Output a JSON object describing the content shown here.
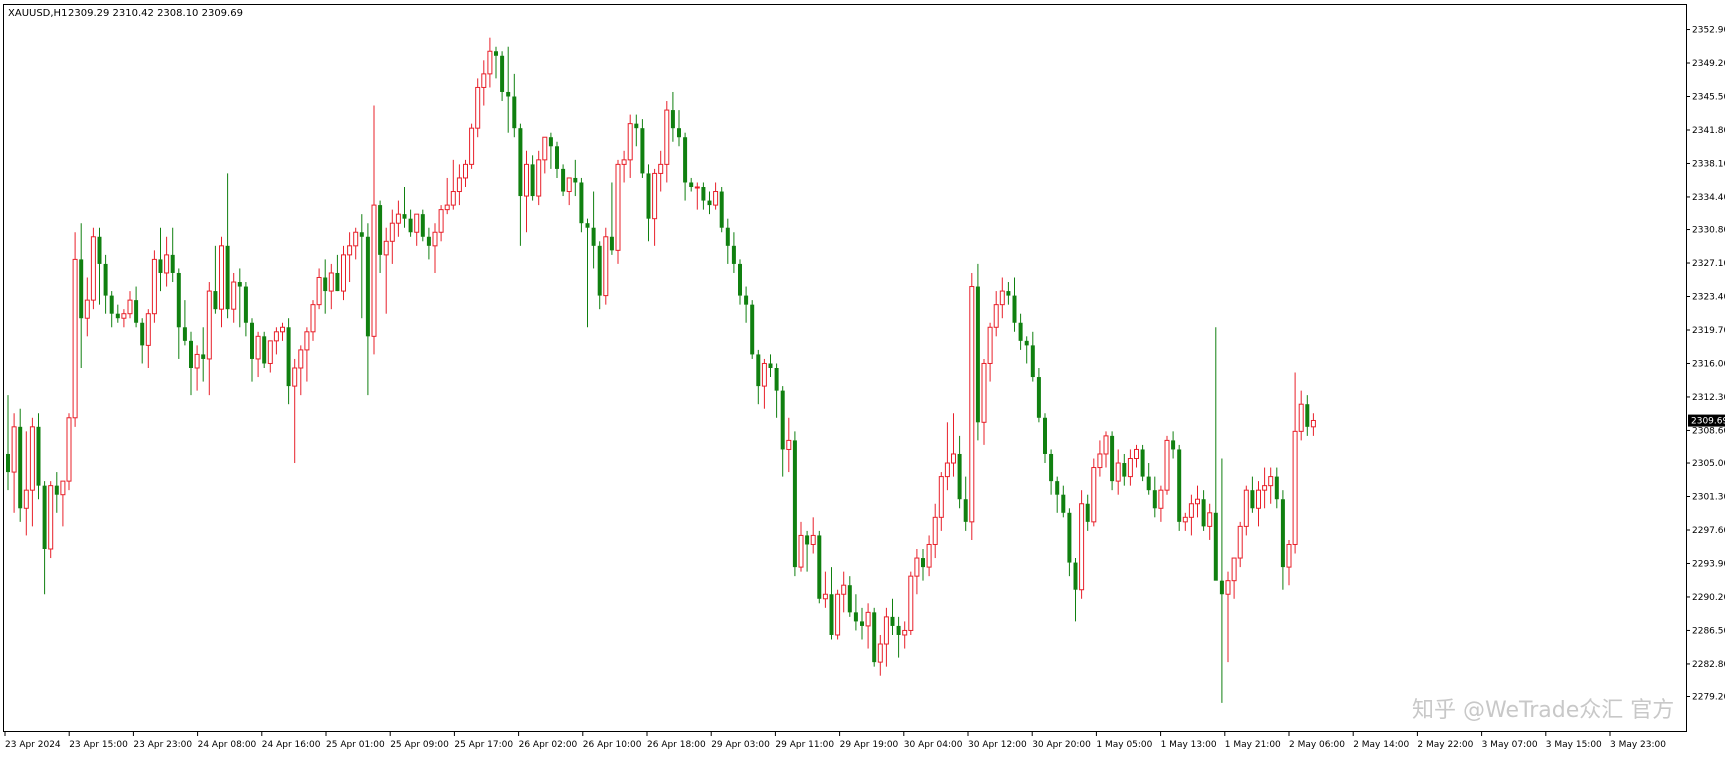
{
  "header": {
    "symbol": "XAUUSD,H1",
    "ohlc": "2309.29 2310.42 2308.10 2309.69"
  },
  "watermark": "知乎 @WeTrade众汇 官方",
  "colors": {
    "bull": "#e8202a",
    "bear": "#108010",
    "axis": "#000000",
    "background": "#ffffff",
    "price_marker": "#000000"
  },
  "chart_data": {
    "type": "candlestick",
    "series_name": "XAUUSD,H1",
    "ylim": [
      2275.5,
      2355.5
    ],
    "grid": false,
    "y_ticks": [
      "2352.90",
      "2349.20",
      "2345.50",
      "2341.80",
      "2338.10",
      "2334.40",
      "2330.80",
      "2327.10",
      "2323.40",
      "2319.70",
      "2316.00",
      "2312.30",
      "2308.60",
      "2305.00",
      "2301.30",
      "2297.60",
      "2293.90",
      "2290.20",
      "2286.50",
      "2282.80",
      "2279.20"
    ],
    "x_ticks": [
      "23 Apr 2024",
      "23 Apr 15:00",
      "23 Apr 23:00",
      "24 Apr 08:00",
      "24 Apr 16:00",
      "25 Apr 01:00",
      "25 Apr 09:00",
      "25 Apr 17:00",
      "26 Apr 02:00",
      "26 Apr 10:00",
      "26 Apr 18:00",
      "29 Apr 03:00",
      "29 Apr 11:00",
      "29 Apr 19:00",
      "30 Apr 04:00",
      "30 Apr 12:00",
      "30 Apr 20:00",
      "1 May 05:00",
      "1 May 13:00",
      "1 May 21:00",
      "2 May 06:00",
      "2 May 14:00",
      "2 May 22:00",
      "3 May 07:00",
      "3 May 15:00",
      "3 May 23:00"
    ],
    "current_price": "2309.69",
    "candles": [
      [
        2306.0,
        2312.5,
        2302.0,
        2304.0
      ],
      [
        2304.0,
        2310.5,
        2299.5,
        2309.0
      ],
      [
        2309.0,
        2311.0,
        2298.5,
        2300.0
      ],
      [
        2300.0,
        2308.5,
        2297.0,
        2302.0
      ],
      [
        2302.0,
        2310.0,
        2298.0,
        2309.0
      ],
      [
        2309.0,
        2310.5,
        2301.0,
        2302.5
      ],
      [
        2302.5,
        2303.0,
        2290.5,
        2295.5
      ],
      [
        2295.5,
        2303.0,
        2294.5,
        2302.5
      ],
      [
        2302.5,
        2304.0,
        2299.5,
        2301.5
      ],
      [
        2301.5,
        2303.0,
        2298.0,
        2303.0
      ],
      [
        2303.0,
        2310.5,
        2302.0,
        2310.0
      ],
      [
        2310.0,
        2330.5,
        2309.0,
        2327.5
      ],
      [
        2327.5,
        2331.5,
        2315.5,
        2321.0
      ],
      [
        2321.0,
        2325.5,
        2319.0,
        2323.0
      ],
      [
        2323.0,
        2331.0,
        2322.0,
        2330.0
      ],
      [
        2330.0,
        2331.0,
        2322.5,
        2327.0
      ],
      [
        2327.0,
        2328.0,
        2321.5,
        2323.5
      ],
      [
        2323.5,
        2324.0,
        2320.0,
        2321.5
      ],
      [
        2321.5,
        2322.5,
        2320.5,
        2321.0
      ],
      [
        2321.0,
        2322.0,
        2320.0,
        2321.5
      ],
      [
        2321.5,
        2324.0,
        2321.0,
        2323.0
      ],
      [
        2323.0,
        2324.5,
        2320.0,
        2320.5
      ],
      [
        2320.5,
        2321.0,
        2316.0,
        2318.0
      ],
      [
        2318.0,
        2322.0,
        2315.5,
        2321.5
      ],
      [
        2321.5,
        2328.5,
        2320.5,
        2327.5
      ],
      [
        2327.5,
        2331.0,
        2324.0,
        2326.0
      ],
      [
        2326.0,
        2330.0,
        2324.5,
        2328.0
      ],
      [
        2328.0,
        2331.0,
        2325.0,
        2326.0
      ],
      [
        2326.0,
        2326.5,
        2316.5,
        2320.0
      ],
      [
        2320.0,
        2323.0,
        2318.0,
        2318.5
      ],
      [
        2318.5,
        2319.5,
        2312.5,
        2315.5
      ],
      [
        2315.5,
        2318.0,
        2313.0,
        2317.0
      ],
      [
        2317.0,
        2320.0,
        2314.0,
        2316.5
      ],
      [
        2316.5,
        2325.0,
        2312.5,
        2324.0
      ],
      [
        2324.0,
        2329.0,
        2321.5,
        2322.0
      ],
      [
        2322.0,
        2330.0,
        2320.0,
        2329.0
      ],
      [
        2329.0,
        2337.0,
        2321.0,
        2322.0
      ],
      [
        2322.0,
        2326.0,
        2320.5,
        2325.0
      ],
      [
        2325.0,
        2326.5,
        2320.0,
        2324.5
      ],
      [
        2324.5,
        2325.0,
        2319.0,
        2320.5
      ],
      [
        2320.5,
        2321.0,
        2314.0,
        2316.5
      ],
      [
        2316.5,
        2319.5,
        2314.5,
        2319.0
      ],
      [
        2319.0,
        2319.5,
        2315.5,
        2316.0
      ],
      [
        2316.0,
        2318.5,
        2315.0,
        2318.5
      ],
      [
        2318.5,
        2320.0,
        2317.0,
        2319.5
      ],
      [
        2319.5,
        2320.5,
        2318.5,
        2320.0
      ],
      [
        2320.0,
        2321.0,
        2311.5,
        2313.5
      ],
      [
        2313.5,
        2316.5,
        2305.0,
        2315.5
      ],
      [
        2315.5,
        2318.0,
        2312.5,
        2317.5
      ],
      [
        2317.5,
        2320.0,
        2314.0,
        2319.5
      ],
      [
        2319.5,
        2323.0,
        2318.5,
        2322.5
      ],
      [
        2322.5,
        2326.5,
        2322.0,
        2325.5
      ],
      [
        2325.5,
        2327.5,
        2321.5,
        2324.0
      ],
      [
        2324.0,
        2327.0,
        2322.0,
        2326.0
      ],
      [
        2326.0,
        2328.0,
        2324.0,
        2324.0
      ],
      [
        2324.0,
        2329.0,
        2323.0,
        2328.0
      ],
      [
        2328.0,
        2330.5,
        2325.0,
        2329.0
      ],
      [
        2329.0,
        2331.0,
        2327.5,
        2330.5
      ],
      [
        2330.5,
        2332.5,
        2321.0,
        2330.0
      ],
      [
        2330.0,
        2331.5,
        2312.5,
        2319.0
      ],
      [
        2319.0,
        2344.5,
        2317.0,
        2333.5
      ],
      [
        2333.5,
        2334.0,
        2326.0,
        2328.0
      ],
      [
        2328.0,
        2331.0,
        2321.5,
        2329.5
      ],
      [
        2329.5,
        2333.0,
        2327.0,
        2331.5
      ],
      [
        2331.5,
        2334.0,
        2330.0,
        2332.5
      ],
      [
        2332.5,
        2335.5,
        2331.0,
        2332.0
      ],
      [
        2332.0,
        2333.0,
        2330.0,
        2330.5
      ],
      [
        2330.5,
        2332.5,
        2329.0,
        2332.5
      ],
      [
        2332.5,
        2333.0,
        2329.5,
        2330.0
      ],
      [
        2330.0,
        2331.0,
        2327.5,
        2329.0
      ],
      [
        2329.0,
        2331.5,
        2326.0,
        2330.5
      ],
      [
        2330.5,
        2333.5,
        2329.5,
        2333.0
      ],
      [
        2333.0,
        2336.5,
        2332.5,
        2333.5
      ],
      [
        2333.5,
        2338.5,
        2333.0,
        2335.0
      ],
      [
        2335.0,
        2338.0,
        2333.5,
        2336.5
      ],
      [
        2336.5,
        2338.5,
        2335.5,
        2338.0
      ],
      [
        2338.0,
        2342.5,
        2337.5,
        2342.0
      ],
      [
        2342.0,
        2347.5,
        2341.0,
        2346.5
      ],
      [
        2346.5,
        2349.5,
        2344.5,
        2348.0
      ],
      [
        2348.0,
        2352.0,
        2346.5,
        2350.5
      ],
      [
        2350.5,
        2351.0,
        2347.5,
        2350.0
      ],
      [
        2350.0,
        2350.5,
        2345.0,
        2346.0
      ],
      [
        2346.0,
        2351.0,
        2341.5,
        2345.5
      ],
      [
        2345.5,
        2348.0,
        2341.0,
        2342.0
      ],
      [
        2342.0,
        2342.5,
        2329.0,
        2334.5
      ],
      [
        2334.5,
        2339.5,
        2330.5,
        2338.0
      ],
      [
        2338.0,
        2339.0,
        2334.0,
        2334.5
      ],
      [
        2334.5,
        2339.5,
        2333.5,
        2338.5
      ],
      [
        2338.5,
        2341.0,
        2337.0,
        2341.0
      ],
      [
        2341.0,
        2341.5,
        2337.5,
        2340.0
      ],
      [
        2340.0,
        2340.5,
        2336.5,
        2337.5
      ],
      [
        2337.5,
        2338.0,
        2334.5,
        2335.0
      ],
      [
        2335.0,
        2336.5,
        2333.5,
        2336.5
      ],
      [
        2336.5,
        2338.5,
        2334.5,
        2336.0
      ],
      [
        2336.0,
        2336.5,
        2330.5,
        2331.5
      ],
      [
        2331.5,
        2332.0,
        2320.0,
        2331.0
      ],
      [
        2331.0,
        2335.0,
        2326.5,
        2329.0
      ],
      [
        2329.0,
        2329.5,
        2322.0,
        2323.5
      ],
      [
        2323.5,
        2331.0,
        2322.5,
        2330.0
      ],
      [
        2330.0,
        2336.0,
        2328.0,
        2328.5
      ],
      [
        2328.5,
        2338.5,
        2327.0,
        2338.0
      ],
      [
        2338.0,
        2339.5,
        2336.0,
        2338.5
      ],
      [
        2338.5,
        2343.5,
        2336.5,
        2342.5
      ],
      [
        2342.5,
        2343.5,
        2340.0,
        2342.0
      ],
      [
        2342.0,
        2343.0,
        2336.5,
        2337.0
      ],
      [
        2337.0,
        2338.0,
        2329.5,
        2332.0
      ],
      [
        2332.0,
        2337.5,
        2329.0,
        2337.0
      ],
      [
        2337.0,
        2339.5,
        2335.0,
        2338.0
      ],
      [
        2338.0,
        2345.0,
        2336.0,
        2344.0
      ],
      [
        2344.0,
        2346.0,
        2340.5,
        2342.0
      ],
      [
        2342.0,
        2344.0,
        2340.0,
        2341.0
      ],
      [
        2341.0,
        2341.5,
        2334.0,
        2336.0
      ],
      [
        2336.0,
        2336.5,
        2335.0,
        2335.5
      ],
      [
        2335.5,
        2336.0,
        2333.0,
        2335.5
      ],
      [
        2335.5,
        2336.0,
        2333.0,
        2334.0
      ],
      [
        2334.0,
        2335.0,
        2332.5,
        2333.5
      ],
      [
        2333.5,
        2336.0,
        2333.0,
        2335.0
      ],
      [
        2335.0,
        2335.5,
        2330.5,
        2331.0
      ],
      [
        2331.0,
        2332.0,
        2327.0,
        2329.0
      ],
      [
        2329.0,
        2330.5,
        2326.0,
        2327.0
      ],
      [
        2327.0,
        2327.5,
        2322.5,
        2323.5
      ],
      [
        2323.5,
        2324.5,
        2320.5,
        2322.5
      ],
      [
        2322.5,
        2323.0,
        2316.5,
        2317.0
      ],
      [
        2317.0,
        2317.5,
        2311.5,
        2313.5
      ],
      [
        2313.5,
        2316.5,
        2311.0,
        2316.0
      ],
      [
        2316.0,
        2317.0,
        2314.5,
        2315.5
      ],
      [
        2315.5,
        2316.0,
        2310.0,
        2313.0
      ],
      [
        2313.0,
        2313.5,
        2303.5,
        2306.5
      ],
      [
        2306.5,
        2310.0,
        2304.0,
        2307.5
      ],
      [
        2307.5,
        2308.5,
        2292.5,
        2293.5
      ],
      [
        2293.5,
        2298.5,
        2293.0,
        2297.0
      ],
      [
        2297.0,
        2297.5,
        2293.0,
        2296.0
      ],
      [
        2296.0,
        2299.0,
        2295.0,
        2297.0
      ],
      [
        2297.0,
        2297.5,
        2289.5,
        2290.0
      ],
      [
        2290.0,
        2293.0,
        2289.0,
        2290.5
      ],
      [
        2290.5,
        2293.5,
        2285.5,
        2286.0
      ],
      [
        2286.0,
        2291.0,
        2285.5,
        2290.5
      ],
      [
        2290.5,
        2293.0,
        2288.5,
        2291.5
      ],
      [
        2291.5,
        2292.5,
        2288.0,
        2288.5
      ],
      [
        2288.5,
        2290.5,
        2286.5,
        2287.5
      ],
      [
        2287.5,
        2289.0,
        2285.5,
        2287.0
      ],
      [
        2287.0,
        2289.5,
        2284.5,
        2288.5
      ],
      [
        2288.5,
        2289.0,
        2282.5,
        2283.0
      ],
      [
        2283.0,
        2286.0,
        2281.5,
        2285.0
      ],
      [
        2285.0,
        2289.0,
        2282.5,
        2288.0
      ],
      [
        2288.0,
        2290.0,
        2286.0,
        2287.0
      ],
      [
        2287.0,
        2288.0,
        2283.5,
        2286.0
      ],
      [
        2286.0,
        2287.5,
        2284.5,
        2286.5
      ],
      [
        2286.5,
        2293.0,
        2286.0,
        2292.5
      ],
      [
        2292.5,
        2295.5,
        2290.5,
        2294.5
      ],
      [
        2294.5,
        2295.5,
        2292.0,
        2293.5
      ],
      [
        2293.5,
        2297.0,
        2292.5,
        2296.0
      ],
      [
        2296.0,
        2300.5,
        2294.5,
        2299.0
      ],
      [
        2299.0,
        2304.0,
        2297.5,
        2303.5
      ],
      [
        2303.5,
        2309.5,
        2302.0,
        2305.0
      ],
      [
        2305.0,
        2310.5,
        2303.5,
        2306.0
      ],
      [
        2306.0,
        2308.0,
        2300.0,
        2301.0
      ],
      [
        2301.0,
        2303.5,
        2297.5,
        2298.5
      ],
      [
        2298.5,
        2326.0,
        2296.5,
        2324.5
      ],
      [
        2324.5,
        2327.0,
        2307.5,
        2309.5
      ],
      [
        2309.5,
        2316.5,
        2307.0,
        2316.0
      ],
      [
        2316.0,
        2320.5,
        2314.0,
        2320.0
      ],
      [
        2320.0,
        2324.0,
        2319.0,
        2322.5
      ],
      [
        2322.5,
        2325.5,
        2321.0,
        2324.0
      ],
      [
        2324.0,
        2325.0,
        2322.5,
        2323.5
      ],
      [
        2323.5,
        2325.5,
        2319.5,
        2320.5
      ],
      [
        2320.5,
        2321.5,
        2317.5,
        2318.5
      ],
      [
        2318.5,
        2319.0,
        2316.0,
        2318.0
      ],
      [
        2318.0,
        2319.5,
        2314.0,
        2314.5
      ],
      [
        2314.5,
        2315.5,
        2309.5,
        2310.0
      ],
      [
        2310.0,
        2310.5,
        2305.0,
        2306.0
      ],
      [
        2306.0,
        2306.5,
        2301.5,
        2303.0
      ],
      [
        2303.0,
        2303.5,
        2299.5,
        2301.5
      ],
      [
        2301.5,
        2302.5,
        2299.0,
        2299.5
      ],
      [
        2299.5,
        2300.0,
        2292.5,
        2294.0
      ],
      [
        2294.0,
        2294.5,
        2287.5,
        2291.0
      ],
      [
        2291.0,
        2302.0,
        2290.0,
        2300.5
      ],
      [
        2300.5,
        2301.5,
        2297.5,
        2298.5
      ],
      [
        2298.5,
        2305.5,
        2298.0,
        2304.5
      ],
      [
        2304.5,
        2307.5,
        2303.5,
        2306.0
      ],
      [
        2306.0,
        2308.5,
        2304.5,
        2308.0
      ],
      [
        2308.0,
        2308.5,
        2302.0,
        2303.0
      ],
      [
        2303.0,
        2306.5,
        2301.5,
        2305.0
      ],
      [
        2305.0,
        2306.0,
        2302.5,
        2303.5
      ],
      [
        2303.5,
        2306.5,
        2302.5,
        2305.5
      ],
      [
        2305.5,
        2307.0,
        2304.5,
        2306.5
      ],
      [
        2306.5,
        2307.0,
        2303.0,
        2303.5
      ],
      [
        2303.5,
        2305.0,
        2301.5,
        2302.0
      ],
      [
        2302.0,
        2303.5,
        2299.0,
        2300.0
      ],
      [
        2300.0,
        2302.5,
        2298.5,
        2302.0
      ],
      [
        2302.0,
        2308.0,
        2301.5,
        2307.5
      ],
      [
        2307.5,
        2308.5,
        2305.5,
        2306.5
      ],
      [
        2306.5,
        2307.0,
        2297.5,
        2298.5
      ],
      [
        2298.5,
        2299.5,
        2297.5,
        2299.0
      ],
      [
        2299.0,
        2301.5,
        2297.0,
        2300.5
      ],
      [
        2300.5,
        2302.5,
        2299.0,
        2301.0
      ],
      [
        2301.0,
        2302.0,
        2297.5,
        2298.0
      ],
      [
        2298.0,
        2300.5,
        2296.5,
        2299.5
      ],
      [
        2299.5,
        2320.0,
        2294.5,
        2292.0
      ],
      [
        2292.0,
        2305.5,
        2278.5,
        2290.5
      ],
      [
        2290.5,
        2293.0,
        2283.0,
        2292.0
      ],
      [
        2292.0,
        2294.5,
        2290.0,
        2294.5
      ],
      [
        2294.5,
        2298.5,
        2293.5,
        2298.0
      ],
      [
        2298.0,
        2302.5,
        2297.0,
        2302.0
      ],
      [
        2302.0,
        2303.5,
        2299.5,
        2300.0
      ],
      [
        2300.0,
        2303.0,
        2298.0,
        2302.0
      ],
      [
        2302.0,
        2304.5,
        2300.0,
        2302.5
      ],
      [
        2302.5,
        2304.5,
        2300.5,
        2303.5
      ],
      [
        2303.5,
        2304.5,
        2300.0,
        2301.0
      ],
      [
        2301.0,
        2302.0,
        2291.0,
        2293.5
      ],
      [
        2293.5,
        2296.5,
        2291.5,
        2296.0
      ],
      [
        2296.0,
        2315.0,
        2295.0,
        2308.5
      ],
      [
        2308.5,
        2313.0,
        2307.5,
        2311.5
      ],
      [
        2311.5,
        2312.5,
        2308.0,
        2309.0
      ],
      [
        2309.0,
        2310.5,
        2308.0,
        2309.7
      ]
    ]
  }
}
